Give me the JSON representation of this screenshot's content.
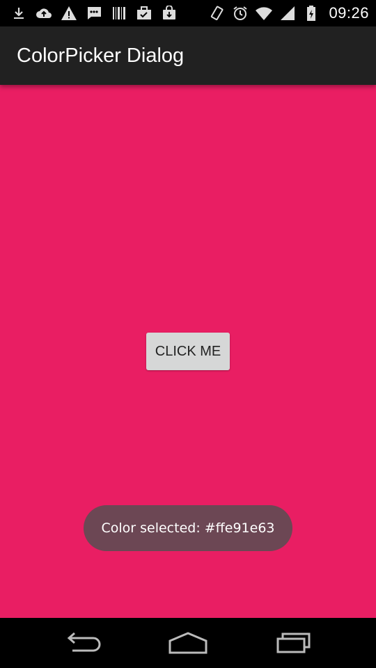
{
  "status_bar": {
    "time": "09:26",
    "left_icons": [
      "download-icon",
      "cloud-upload-icon",
      "warning-icon",
      "message-icon",
      "barcode-icon",
      "briefcase-check-icon",
      "bag-icon"
    ],
    "right_icons": [
      "vibrate-icon",
      "alarm-icon",
      "wifi-icon",
      "signal-icon",
      "battery-icon"
    ]
  },
  "action_bar": {
    "title": "ColorPicker Dialog"
  },
  "main": {
    "background_color": "#e91e63",
    "button_label": "CLICK ME"
  },
  "toast": {
    "text": "Color selected: #ffe91e63"
  },
  "nav_bar": {
    "buttons": [
      "back-icon",
      "home-icon",
      "recents-icon"
    ]
  }
}
